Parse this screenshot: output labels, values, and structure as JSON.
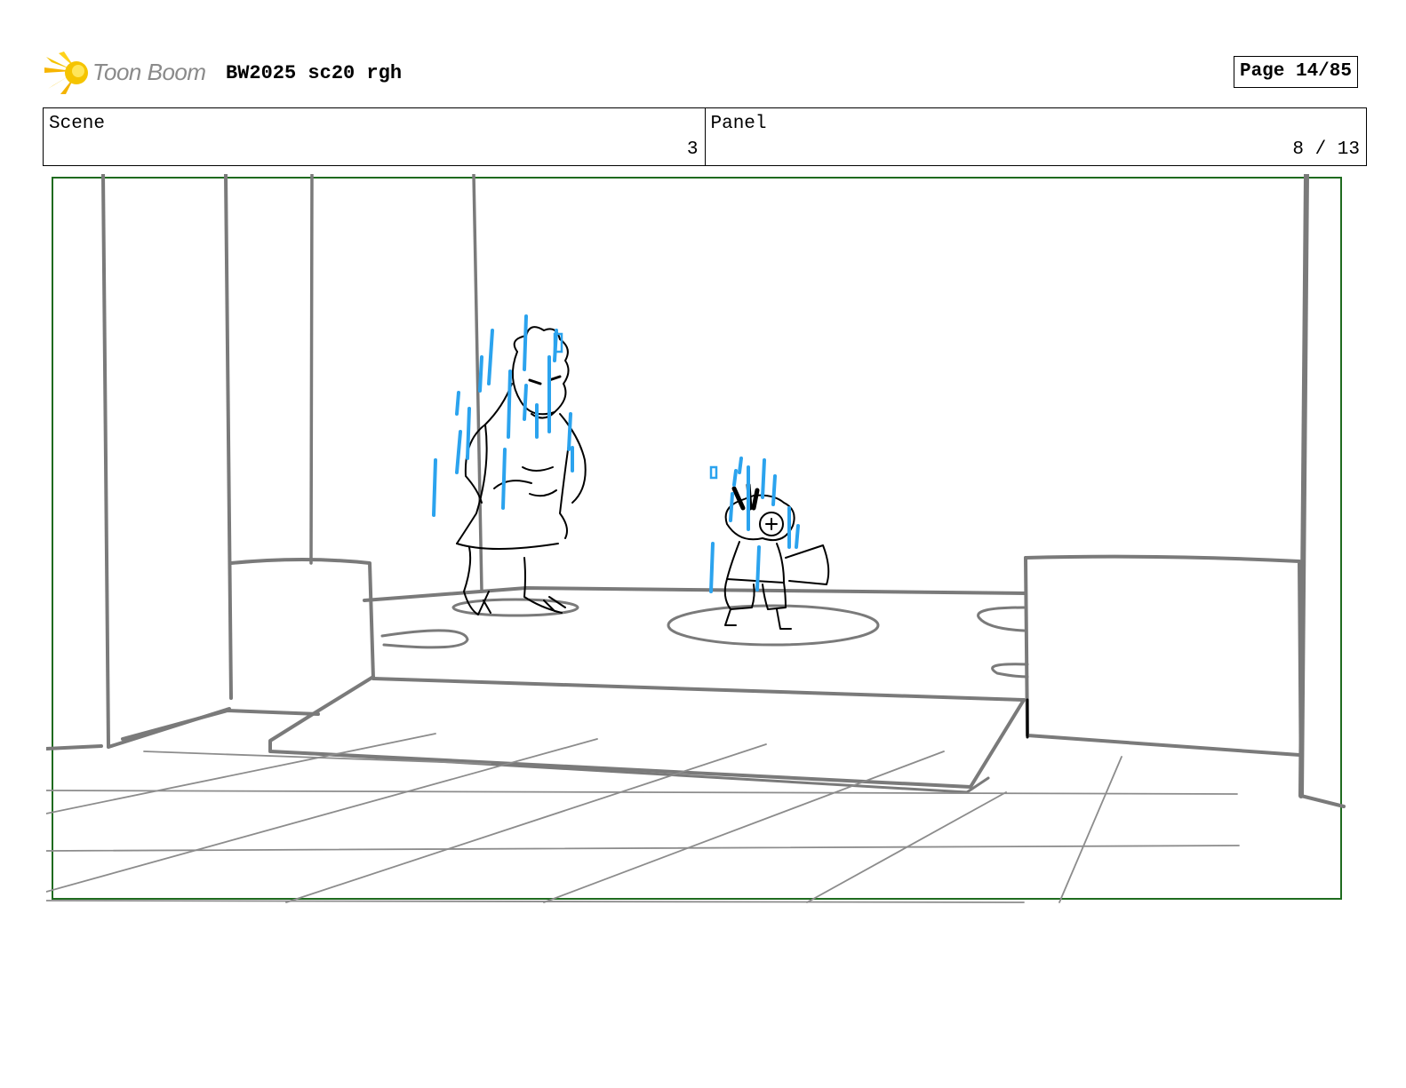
{
  "header": {
    "brand": "Toon Boom",
    "title": "BW2025 sc20 rgh",
    "page": "Page 14/85"
  },
  "info": {
    "scene_label": "Scene",
    "scene_value": "3",
    "panel_label": "Panel",
    "panel_value": "8 / 13"
  },
  "colors": {
    "frame": "#1f6b1f",
    "sketch": "#7a7a7a",
    "ink": "#000000",
    "effect": "#2ba3ee",
    "logo_yellow": "#f5c400"
  }
}
